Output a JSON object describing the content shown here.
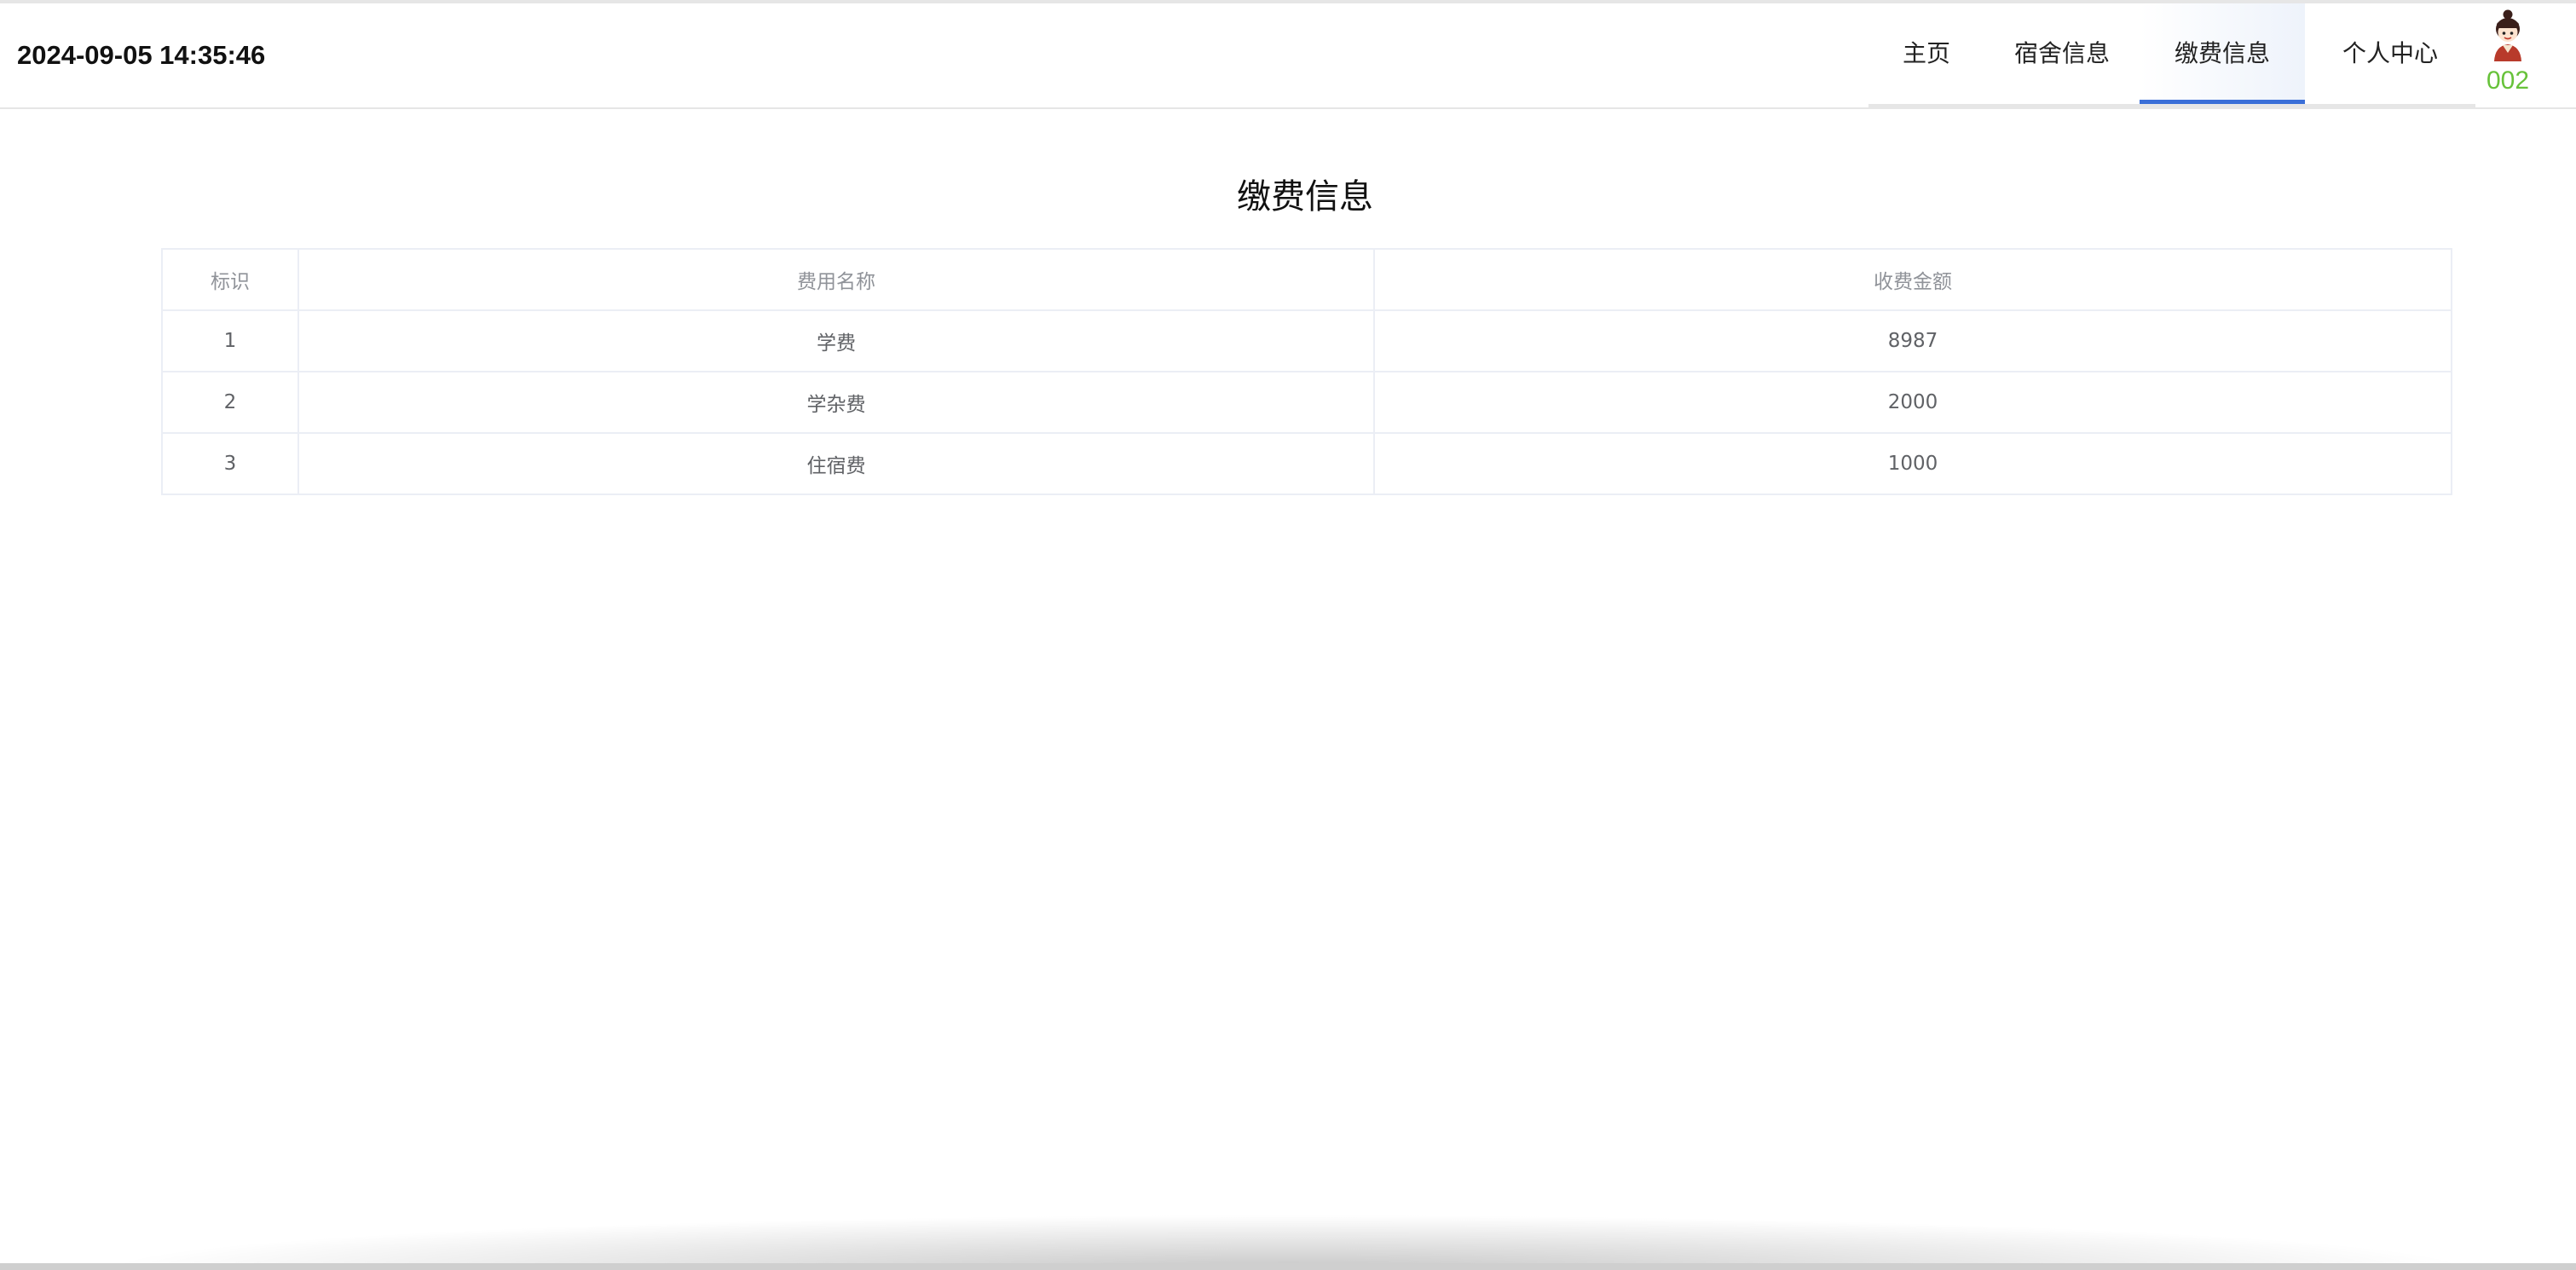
{
  "header": {
    "datetime": "2024-09-05 14:35:46",
    "nav": [
      {
        "label": "主页"
      },
      {
        "label": "宿舍信息"
      },
      {
        "label": "缴费信息"
      },
      {
        "label": "个人中心"
      }
    ],
    "active_nav_index": 2,
    "user": {
      "id": "002",
      "id_color": "#67c23a"
    },
    "accent_color": "#3b6fd8"
  },
  "main": {
    "title": "缴费信息",
    "table": {
      "headers": [
        "标识",
        "费用名称",
        "收费金额"
      ],
      "rows": [
        [
          "1",
          "学费",
          "8987"
        ],
        [
          "2",
          "学杂费",
          "2000"
        ],
        [
          "3",
          "住宿费",
          "1000"
        ]
      ]
    }
  }
}
